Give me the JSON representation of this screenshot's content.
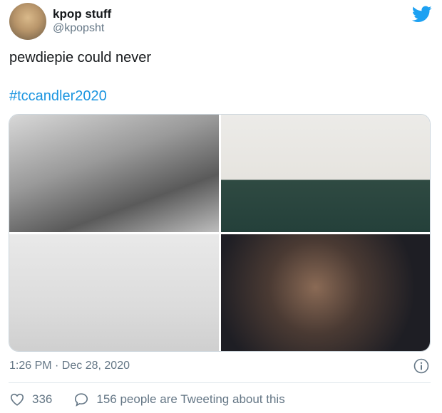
{
  "author": {
    "name": "kpop stuff",
    "handle": "@kpopsht"
  },
  "tweet": {
    "text": "pewdiepie could never",
    "hashtag": "#tccandler2020",
    "timestamp": "1:26 PM · Dec 28, 2020"
  },
  "engagement": {
    "likes": "336",
    "people_tweeting": "156 people are Tweeting about this"
  },
  "colors": {
    "link": "#1b95e0",
    "secondary_text": "#657786",
    "twitter_blue": "#1da1f2"
  },
  "icons": [
    "twitter-bird-icon",
    "info-icon",
    "heart-icon",
    "speech-bubble-icon"
  ]
}
